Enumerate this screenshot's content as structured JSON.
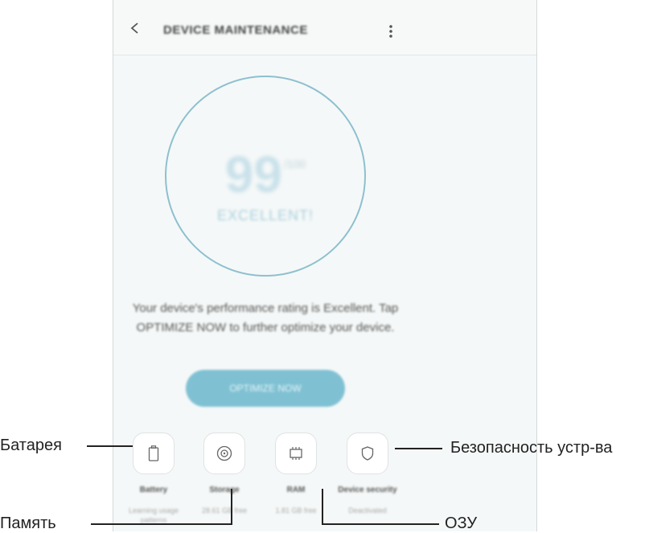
{
  "header": {
    "title": "DEVICE MAINTENANCE"
  },
  "score": {
    "value": "99",
    "max": "/100",
    "rating": "EXCELLENT!"
  },
  "description": "Your device's performance rating is Excellent. Tap OPTIMIZE NOW to further optimize your device.",
  "optimize_button": "OPTIMIZE NOW",
  "tools": [
    {
      "label": "Battery",
      "sub": "Learning usage patterns"
    },
    {
      "label": "Storage",
      "sub": "28.61 GB free"
    },
    {
      "label": "RAM",
      "sub": "1.81 GB free"
    },
    {
      "label": "Device security",
      "sub": "Deactivated"
    }
  ],
  "callouts": {
    "battery": "Батарея",
    "storage": "Память",
    "ram": "ОЗУ",
    "security": "Безопасность устр-ва"
  },
  "colors": {
    "accent": "#7fc1d3",
    "ring": "#8ec0cf"
  }
}
